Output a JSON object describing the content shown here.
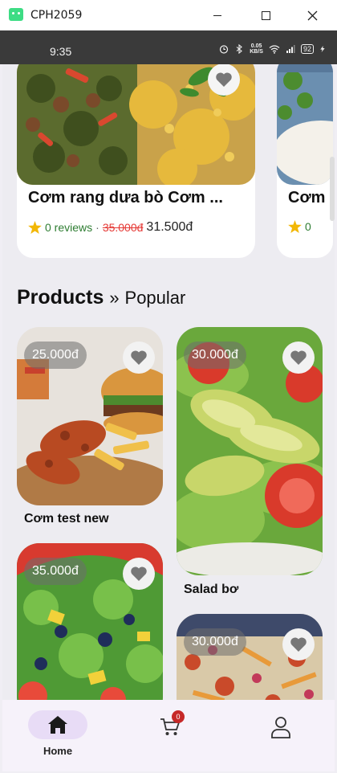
{
  "window": {
    "title": "CPH2059"
  },
  "status_bar": {
    "time": "9:35",
    "speed_value": "0.05",
    "speed_unit": "KB/S",
    "battery": "92"
  },
  "featured": [
    {
      "name": "Cơm rang dưa bò Cơm ...",
      "rating_icon": "star",
      "reviews": "0 reviews",
      "separator": "·",
      "old_price": "35.000đ",
      "new_price": "31.500đ"
    },
    {
      "name": "Cơm",
      "rating_icon": "star",
      "reviews": "0"
    }
  ],
  "section": {
    "title": "Products",
    "separator": "»",
    "subtitle": "Popular"
  },
  "products": [
    {
      "name": "Cơm test new",
      "price": "25.000đ"
    },
    {
      "name": "Salad bơ",
      "price": "30.000đ"
    },
    {
      "name": "",
      "price": "35.000đ"
    },
    {
      "name": "",
      "price": "30.000đ"
    }
  ],
  "nav": {
    "home_label": "Home",
    "cart_badge": "0"
  },
  "colors": {
    "accent_pill": "#e8dcf6",
    "review_green": "#2e7d32",
    "old_price_red": "#e53935",
    "star": "#f2b705"
  }
}
